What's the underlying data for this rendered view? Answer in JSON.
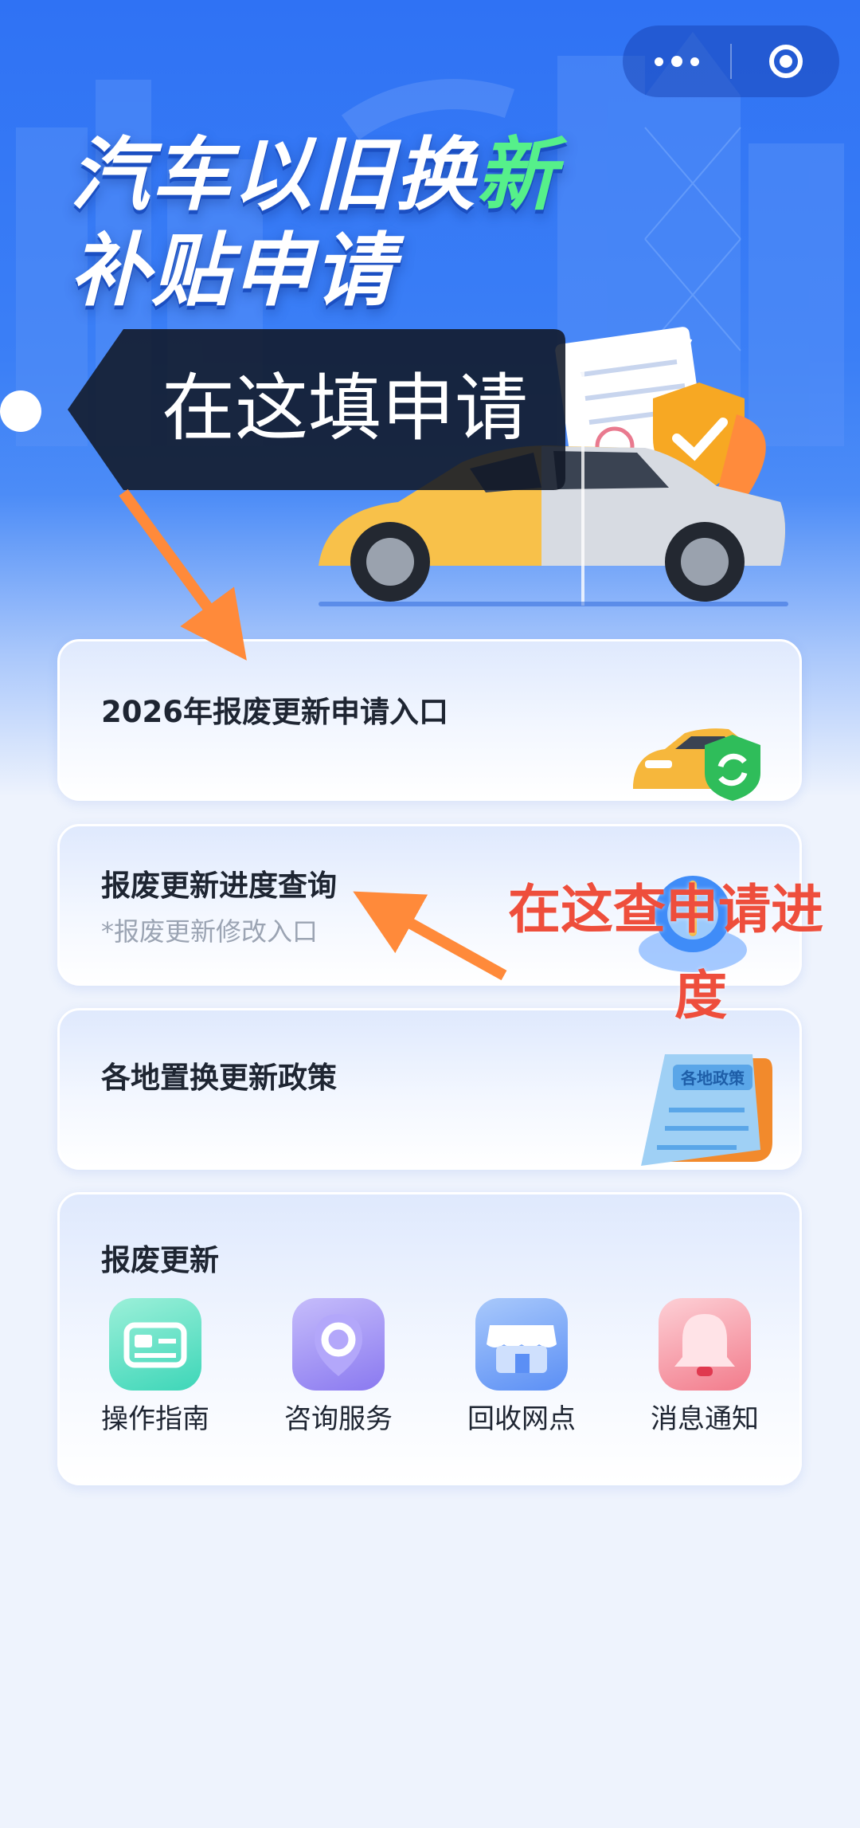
{
  "capsule": {
    "more_icon": "more-dots-icon",
    "close_icon": "target-close-icon"
  },
  "hero": {
    "title_line1_a": "汽车以旧换",
    "title_line1_b": "新",
    "title_line2": "补贴申请"
  },
  "annotations": {
    "fill_here": "在这填申请",
    "check_progress_line1": "在这查申请进",
    "check_progress_line2": "度"
  },
  "cards": {
    "apply": {
      "title": "2026年报废更新申请入口"
    },
    "progress": {
      "title": "报废更新进度查询",
      "subtitle": "*报废更新修改入口"
    },
    "policy": {
      "title": "各地置换更新政策",
      "badge": "各地政策"
    },
    "scrap": {
      "title": "报废更新",
      "items": [
        {
          "label": "操作指南",
          "icon": "guide-card-icon",
          "color": "#3dd6b8"
        },
        {
          "label": "咨询服务",
          "icon": "consult-pin-icon",
          "color": "#8a79f0"
        },
        {
          "label": "回收网点",
          "icon": "store-icon",
          "color": "#5b8ff5"
        },
        {
          "label": "消息通知",
          "icon": "bell-icon",
          "color": "#f27b8b"
        }
      ]
    }
  },
  "colors": {
    "primary": "#2f72f4",
    "annotation": "#ee4e3c",
    "arrow": "#ff8a3a"
  }
}
